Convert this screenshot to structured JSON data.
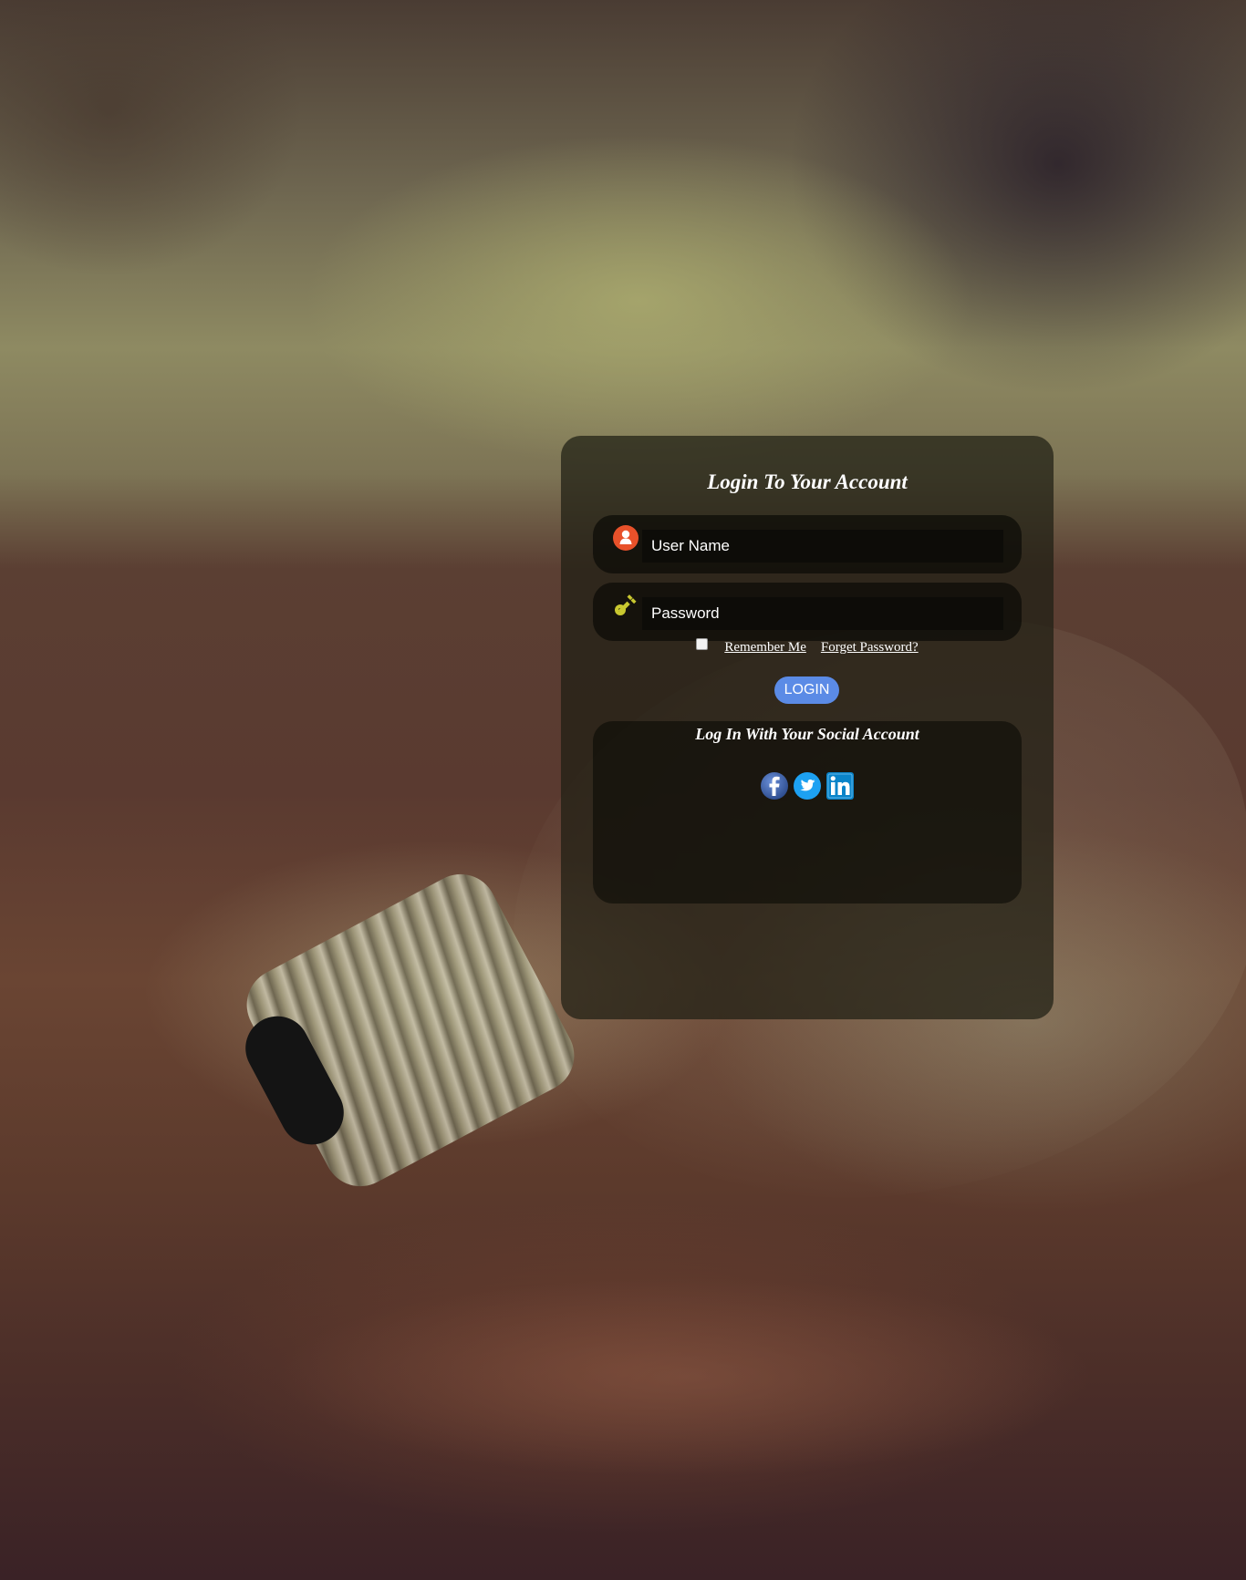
{
  "login": {
    "title": "Login To Your Account",
    "username_placeholder": "User Name",
    "password_placeholder": "Password",
    "remember_label": "Remember Me",
    "forgot_label": "Forget Password?",
    "login_button": "LOGIN",
    "remember_checked": false
  },
  "social": {
    "title": "Log In With Your Social Account",
    "icons": [
      "facebook-icon",
      "twitter-icon",
      "linkedin-icon"
    ]
  },
  "colors": {
    "login_button": "#5b8be6",
    "user_icon": "#e8512a",
    "key_icon": "#c9c830",
    "facebook": "#3b5998",
    "twitter": "#1da1f2",
    "linkedin": "#0a84c9"
  }
}
